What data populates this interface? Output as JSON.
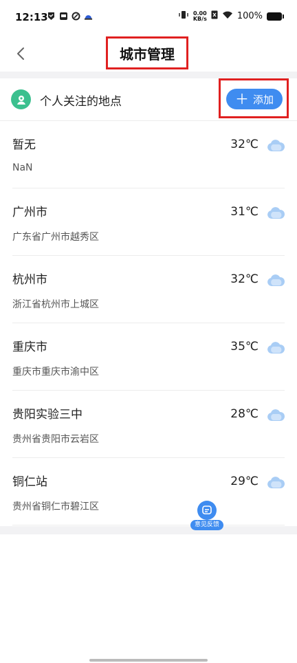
{
  "status_bar": {
    "time": "12:13",
    "net_speed_value": "0.00",
    "net_speed_unit": "KB/s",
    "battery_text": "100%"
  },
  "header": {
    "title": "城市管理"
  },
  "section": {
    "title": "个人关注的地点",
    "add_label": "添加"
  },
  "cities": [
    {
      "name": "暂无",
      "address": "NaN",
      "temp": "32℃"
    },
    {
      "name": "广州市",
      "address": "广东省广州市越秀区",
      "temp": "31℃"
    },
    {
      "name": "杭州市",
      "address": "浙江省杭州市上城区",
      "temp": "32℃"
    },
    {
      "name": "重庆市",
      "address": "重庆市重庆市渝中区",
      "temp": "35℃"
    },
    {
      "name": "贵阳实验三中",
      "address": "贵州省贵阳市云岩区",
      "temp": "28℃"
    },
    {
      "name": "铜仁站",
      "address": "贵州省铜仁市碧江区",
      "temp": "29℃"
    }
  ],
  "feedback": {
    "label": "意见反馈"
  },
  "colors": {
    "accent": "#3f8cf0",
    "highlight_border": "#e02020",
    "section_icon": "#3cc08f"
  },
  "icons": {
    "back": "chevron-left-icon",
    "section": "location-person-icon",
    "weather": "cloud-icon",
    "feedback": "chat-icon"
  }
}
